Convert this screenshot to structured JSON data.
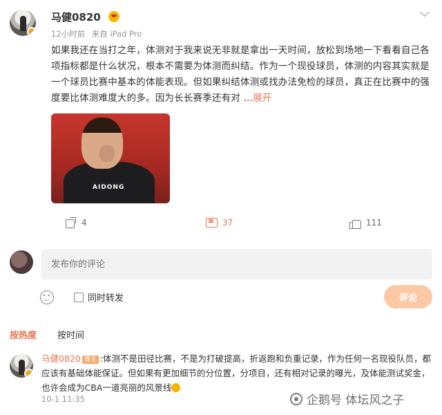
{
  "post": {
    "username": "马健0820",
    "time": "12小时前",
    "source": "来自 iPad Pro",
    "text": "如果我还在当打之年，体测对于我来说无非就是拿出一天时间，放松到场地一下看看自己各项指标都是什么状况，根本不需要为体测而纠结。作为一个现役球员，体测的内容其实就是一个球员比赛中基本的体能表现。但如果纠结体测或找办法免检的球员，真正在比赛中的强度要比体测难度大的多。因为长长赛季还有对 ...",
    "expand_label": "展开",
    "image_jersey_text": "AIDONG",
    "shares": "4",
    "comments": "37",
    "likes": "111"
  },
  "composer": {
    "placeholder": "发布你的评论",
    "repost_label": "同时转发",
    "submit_label": "评论"
  },
  "sort": {
    "hot": "按热度",
    "time": "按时间"
  },
  "comment": {
    "author": "马健0820",
    "tag": "博主",
    "text": ":体测不是田径比赛，不是为打破提高，折返跑和负重记录，作为任何一名现役队员，都应该有基础体能保证。但如果有更加细节的分位置，分项目，还有相对记录的曝光，及体能测试奖金，也许会成为CBA一道亮丽的风景线",
    "time": "10-1 11:35"
  },
  "watermark": "企鹅号 体坛风之子",
  "colors": {
    "accent": "#eb7350",
    "button_disabled": "#fbc9a3"
  }
}
